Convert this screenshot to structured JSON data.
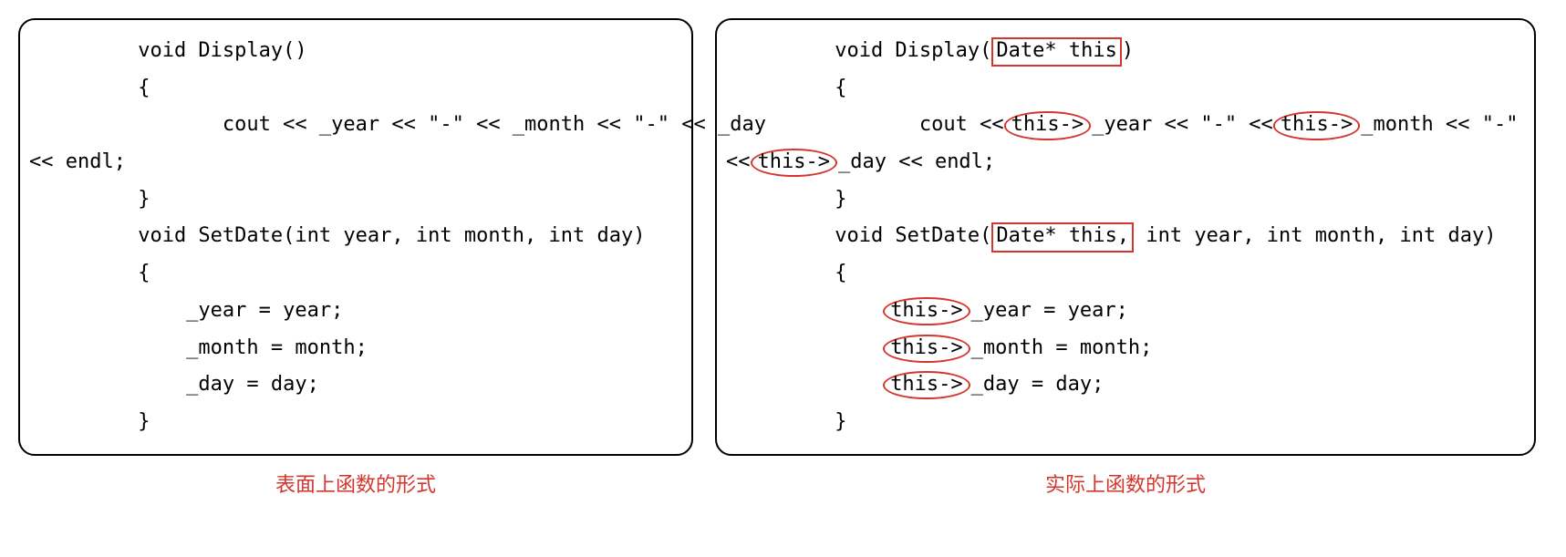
{
  "left": {
    "caption": "表面上函数的形式",
    "lines": {
      "l1": "         void Display()",
      "l2": "         {",
      "l3": "                cout << _year << \"-\" << _month << \"-\" << _day",
      "l4": "<< endl;",
      "l5": "         }",
      "l6": "         void SetDate(int year, int month, int day)",
      "l7": "         {",
      "l8": "             _year = year;",
      "l9": "             _month = month;",
      "l10": "             _day = day;",
      "l11": "         }"
    }
  },
  "right": {
    "caption": "实际上函数的形式",
    "lines": {
      "l1a": "         void Display(",
      "l1_box": "Date* this",
      "l1b": ")",
      "l2": "         {",
      "l3a": "                cout <<",
      "l3_ov1": "this->",
      "l3b": "_year << \"-\" <<",
      "l3_ov2": "this->",
      "l3c": "_month << \"-\"",
      "l4a": "<<",
      "l4_ov": "this->",
      "l4b": "_day << endl;",
      "l5": "         }",
      "l6a": "         void SetDate(",
      "l6_box": "Date* this,",
      "l6b": " int year, int month, int day)",
      "l7": "         {",
      "l8a": "             ",
      "l8_ov": "this->",
      "l8b": "_year = year;",
      "l9a": "             ",
      "l9_ov": "this->",
      "l9b": "_month = month;",
      "l10a": "             ",
      "l10_ov": "this->",
      "l10b": "_day = day;",
      "l11": "         }"
    }
  }
}
